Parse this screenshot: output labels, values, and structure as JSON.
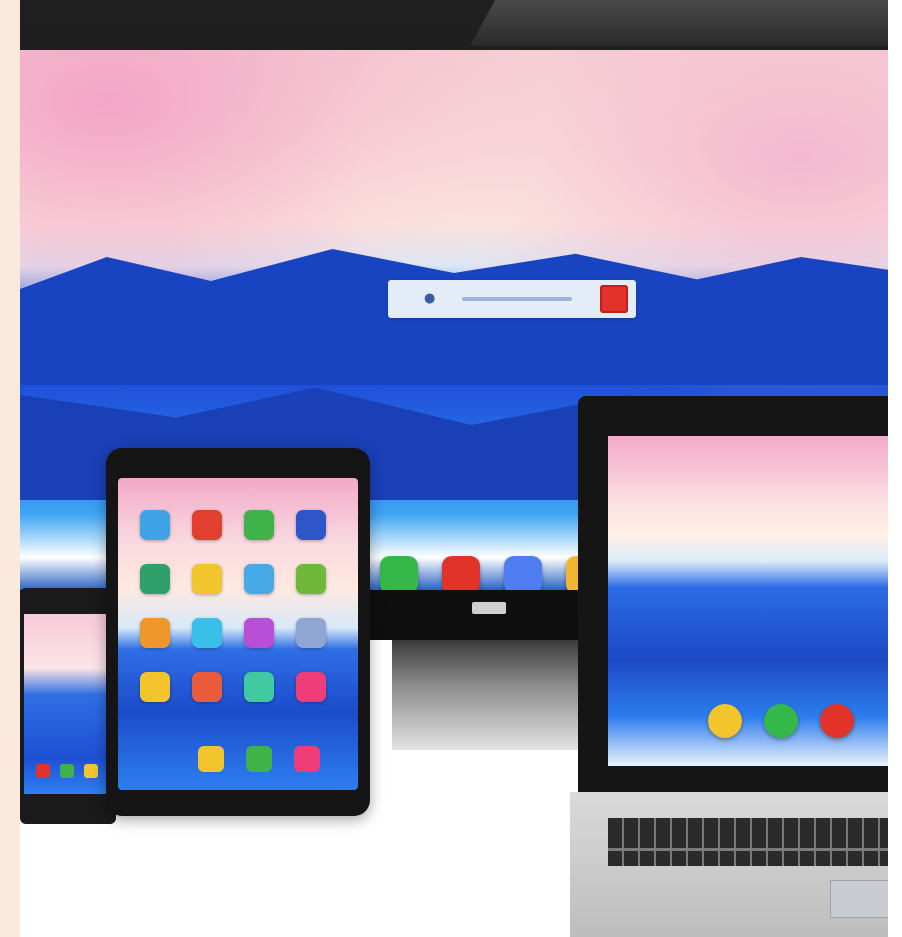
{
  "scene": {
    "palette": {
      "sky_pink": "#f3a6c6",
      "sea_blue": "#1e4fd8",
      "bezel_black": "#151515",
      "accent_red": "#e2332b"
    },
    "monitor": {
      "search_widget": {
        "icon": "search-icon"
      },
      "dock_icon_colors": [
        "#35b84a",
        "#e2332b",
        "#4f7cf0",
        "#f2b531"
      ]
    },
    "tablet": {
      "app_icon_colors": [
        "#3fa4e6",
        "#e2402e",
        "#3fb24a",
        "#2f56c8",
        "#2fa06a",
        "#f2c52d",
        "#47a9e6",
        "#6fb83a",
        "#f0972c",
        "#39c0e8",
        "#b84fd6",
        "#8fa6d2",
        "#f2c52d",
        "#e95b3a",
        "#41c9a0",
        "#ef3d7a"
      ],
      "dock_icon_colors": [
        "#f2c52d",
        "#3fb24a",
        "#ef3d7a"
      ]
    },
    "phone": {
      "app_icon_colors": [
        "#e2332b",
        "#3fb24a",
        "#f2c52d",
        "#4f7cf0"
      ]
    },
    "laptop": {
      "app_icon_colors": [
        "#f2c52d",
        "#35b84a",
        "#e2332b"
      ]
    }
  }
}
